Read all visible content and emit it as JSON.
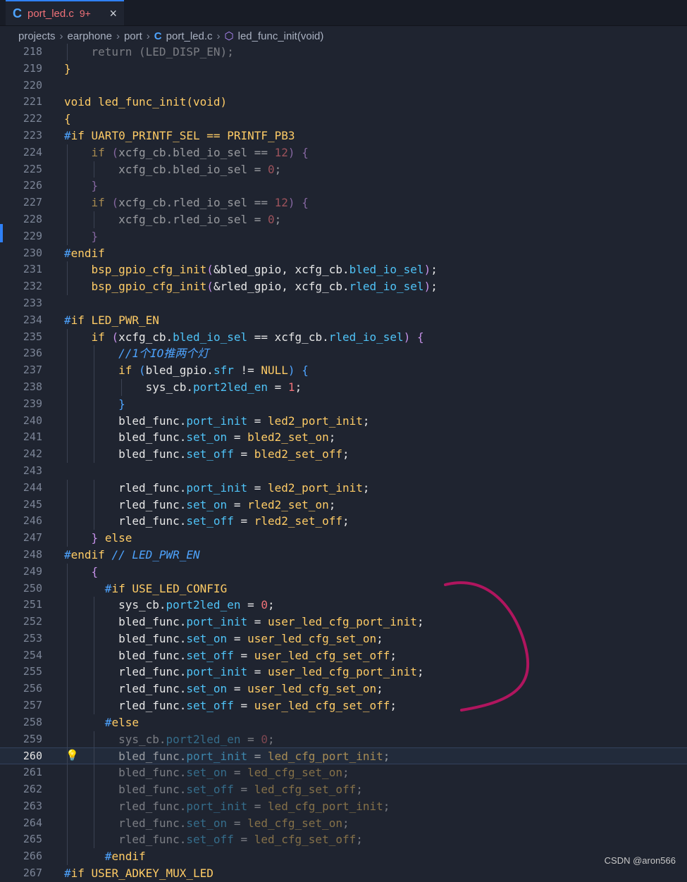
{
  "tab": {
    "icon": "c-language-icon",
    "name": "port_led.c",
    "badge": "9+",
    "close": "×"
  },
  "breadcrumb": [
    "projects",
    "earphone",
    "port",
    "port_led.c",
    "led_func_init(void)"
  ],
  "editor": {
    "lines": [
      {
        "n": "218",
        "html": "<span class=\"dim\">    return (LED_DISP_EN);</span>"
      },
      {
        "n": "219",
        "html": "<span class=\"kw\">}</span>"
      },
      {
        "n": "220",
        "html": ""
      },
      {
        "n": "221",
        "html": "<span class=\"fn\">void led_func_init(void)</span>"
      },
      {
        "n": "222",
        "html": "<span class=\"kw\">{</span>"
      },
      {
        "n": "223",
        "html": "<span class=\"pp\">#</span><span class=\"kw\">if UART0_PRINTF_SEL == PRINTF_PB3</span>"
      },
      {
        "n": "224",
        "html": "<span class=\"dim2\">    <span class=\"kw\">if</span> <span class=\"br\">(</span>xcfg_cb.bled_io_sel <span class=\"op\">==</span> <span class=\"num\">12</span><span class=\"br\">)</span> <span class=\"br\">{</span></span>"
      },
      {
        "n": "225",
        "html": "<span class=\"dim2\">        xcfg_cb.bled_io_sel <span class=\"op\">=</span> <span class=\"num\">0</span>;</span>"
      },
      {
        "n": "226",
        "html": "<span class=\"dim2\">    <span class=\"br\">}</span></span>"
      },
      {
        "n": "227",
        "html": "<span class=\"dim2\">    <span class=\"kw\">if</span> <span class=\"br\">(</span>xcfg_cb.rled_io_sel <span class=\"op\">==</span> <span class=\"num\">12</span><span class=\"br\">)</span> <span class=\"br\">{</span></span>"
      },
      {
        "n": "228",
        "html": "<span class=\"dim2\">        xcfg_cb.rled_io_sel <span class=\"op\">=</span> <span class=\"num\">0</span>;</span>"
      },
      {
        "n": "229",
        "html": "<span class=\"dim2\">    <span class=\"br\">}</span></span>"
      },
      {
        "n": "230",
        "html": "<span class=\"pp\">#</span><span class=\"kw\">endif</span>"
      },
      {
        "n": "231",
        "html": "    <span class=\"fn\">bsp_gpio_cfg_init</span><span class=\"br\">(</span>&amp;bled_gpio, xcfg_cb.<span class=\"mem\">bled_io_sel</span><span class=\"br\">)</span>;"
      },
      {
        "n": "232",
        "html": "    <span class=\"fn\">bsp_gpio_cfg_init</span><span class=\"br\">(</span>&amp;rled_gpio, xcfg_cb.<span class=\"mem\">rled_io_sel</span><span class=\"br\">)</span>;"
      },
      {
        "n": "233",
        "html": ""
      },
      {
        "n": "234",
        "html": "<span class=\"pp\">#</span><span class=\"kw\">if LED_PWR_EN</span>"
      },
      {
        "n": "235",
        "html": "    <span class=\"kw\">if</span> <span class=\"br\">(</span>xcfg_cb.<span class=\"mem\">bled_io_sel</span> <span class=\"op\">==</span> xcfg_cb.<span class=\"mem\">rled_io_sel</span><span class=\"br\">)</span> <span class=\"br\">{</span>"
      },
      {
        "n": "236",
        "html": "        <span class=\"cm\">//1个IO推两个灯</span>"
      },
      {
        "n": "237",
        "html": "        <span class=\"kw\">if</span> <span class=\"br2\">(</span>bled_gpio.<span class=\"mem\">sfr</span> <span class=\"op\">!=</span> <span class=\"mac\">NULL</span><span class=\"br2\">)</span> <span class=\"br2\">{</span>"
      },
      {
        "n": "238",
        "html": "            sys_cb.<span class=\"mem\">port2led_en</span> <span class=\"op\">=</span> <span class=\"num\">1</span>;"
      },
      {
        "n": "239",
        "html": "        <span class=\"br2\">}</span>"
      },
      {
        "n": "240",
        "html": "        bled_func.<span class=\"mem\">port_init</span> <span class=\"op\">=</span> <span class=\"fn\">led2_port_init</span>;"
      },
      {
        "n": "241",
        "html": "        bled_func.<span class=\"mem\">set_on</span> <span class=\"op\">=</span> <span class=\"fn\">bled2_set_on</span>;"
      },
      {
        "n": "242",
        "html": "        bled_func.<span class=\"mem\">set_off</span> <span class=\"op\">=</span> <span class=\"fn\">bled2_set_off</span>;"
      },
      {
        "n": "243",
        "html": ""
      },
      {
        "n": "244",
        "html": "        rled_func.<span class=\"mem\">port_init</span> <span class=\"op\">=</span> <span class=\"fn\">led2_port_init</span>;"
      },
      {
        "n": "245",
        "html": "        rled_func.<span class=\"mem\">set_on</span> <span class=\"op\">=</span> <span class=\"fn\">rled2_set_on</span>;"
      },
      {
        "n": "246",
        "html": "        rled_func.<span class=\"mem\">set_off</span> <span class=\"op\">=</span> <span class=\"fn\">rled2_set_off</span>;"
      },
      {
        "n": "247",
        "html": "    <span class=\"br\">}</span> <span class=\"kw\">else</span>"
      },
      {
        "n": "248",
        "html": "<span class=\"pp\">#</span><span class=\"kw\">endif</span> <span class=\"cm\">// LED_PWR_EN</span>"
      },
      {
        "n": "249",
        "html": "    <span class=\"br\">{</span>"
      },
      {
        "n": "250",
        "html": "      <span class=\"pp\">#</span><span class=\"kw\">if USE_LED_CONFIG</span>"
      },
      {
        "n": "251",
        "html": "        sys_cb.<span class=\"mem\">port2led_en</span> <span class=\"op\">=</span> <span class=\"num\">0</span>;"
      },
      {
        "n": "252",
        "html": "        bled_func.<span class=\"mem\">port_init</span> <span class=\"op\">=</span> <span class=\"fn\">user_led_cfg_port_init</span>;"
      },
      {
        "n": "253",
        "html": "        bled_func.<span class=\"mem\">set_on</span> <span class=\"op\">=</span> <span class=\"fn\">user_led_cfg_set_on</span>;"
      },
      {
        "n": "254",
        "html": "        bled_func.<span class=\"mem\">set_off</span> <span class=\"op\">=</span> <span class=\"fn\">user_led_cfg_set_off</span>;"
      },
      {
        "n": "255",
        "html": "        rled_func.<span class=\"mem\">port_init</span> <span class=\"op\">=</span> <span class=\"fn\">user_led_cfg_port_init</span>;"
      },
      {
        "n": "256",
        "html": "        rled_func.<span class=\"mem\">set_on</span> <span class=\"op\">=</span> <span class=\"fn\">user_led_cfg_set_on</span>;"
      },
      {
        "n": "257",
        "html": "        rled_func.<span class=\"mem\">set_off</span> <span class=\"op\">=</span> <span class=\"fn\">user_led_cfg_set_off</span>;"
      },
      {
        "n": "258",
        "html": "      <span class=\"pp\">#</span><span class=\"kw\">else</span>"
      },
      {
        "n": "259",
        "html": "<span class=\"dim\">        sys_cb.<span class=\"mem\">port2led_en</span> = <span class=\"num\">0</span>;</span>"
      },
      {
        "n": "260",
        "html": "<span class=\"dim2\">        bled_func.<span class=\"mem\">port_init</span> = <span class=\"fn\">led_cfg_port_init</span>;</span>",
        "current": true
      },
      {
        "n": "261",
        "html": "<span class=\"dim\">        bled_func.<span class=\"mem\">set_on</span> = <span class=\"fn\">led_cfg_set_on</span>;</span>"
      },
      {
        "n": "262",
        "html": "<span class=\"dim\">        bled_func.<span class=\"mem\">set_off</span> = <span class=\"fn\">led_cfg_set_off</span>;</span>"
      },
      {
        "n": "263",
        "html": "<span class=\"dim\">        rled_func.<span class=\"mem\">port_init</span> = <span class=\"fn\">led_cfg_port_init</span>;</span>"
      },
      {
        "n": "264",
        "html": "<span class=\"dim\">        rled_func.<span class=\"mem\">set_on</span> = <span class=\"fn\">led_cfg_set_on</span>;</span>"
      },
      {
        "n": "265",
        "html": "<span class=\"dim\">        rled_func.<span class=\"mem\">set_off</span> = <span class=\"fn\">led_cfg_set_off</span>;</span>"
      },
      {
        "n": "266",
        "html": "      <span class=\"pp\">#</span><span class=\"kw\">endif</span>"
      },
      {
        "n": "267",
        "html": "<span class=\"pp\">#</span><span class=\"kw\">if USER_ADKEY_MUX_LED</span>"
      }
    ]
  },
  "watermark": "CSDN @aron566",
  "colors": {
    "annotation": "#b0155e",
    "accent": "#2f81f7"
  }
}
